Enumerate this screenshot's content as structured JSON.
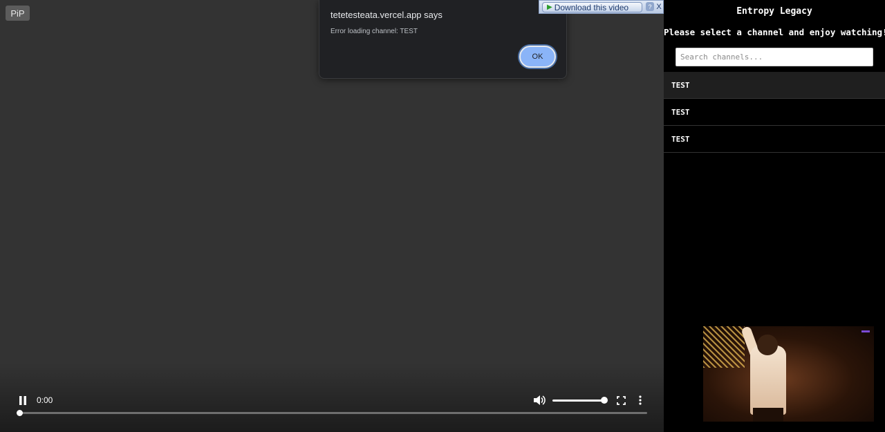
{
  "video": {
    "pip_label": "PiP",
    "current_time": "0:00",
    "progress": 0,
    "volume": 0.95
  },
  "dialog": {
    "title": "tetetesteata.vercel.app says",
    "message": "Error loading channel: TEST",
    "ok_label": "OK"
  },
  "download_bar": {
    "label": "Download this video",
    "help_label": "?",
    "close_label": "X"
  },
  "sidebar": {
    "title": "Entropy Legacy",
    "welcome": "Please select a channel and enjoy watching!",
    "search_placeholder": "Search channels...",
    "channels": [
      {
        "name": "TEST"
      },
      {
        "name": "TEST"
      },
      {
        "name": "TEST"
      }
    ]
  }
}
